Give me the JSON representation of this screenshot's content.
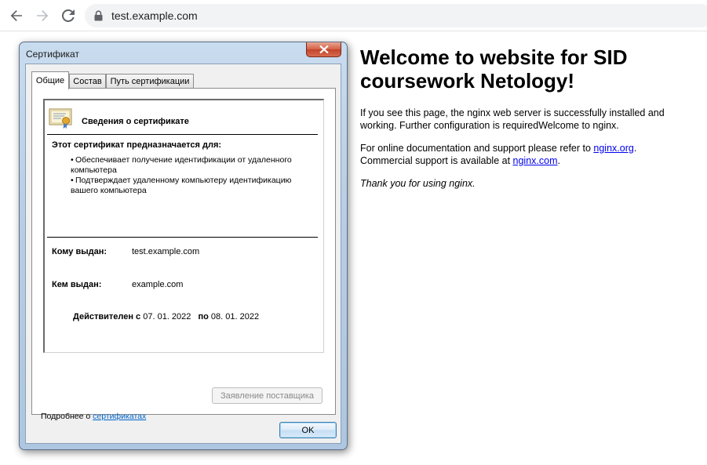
{
  "browser": {
    "url": "test.example.com",
    "back_icon": "arrow-left-icon",
    "forward_icon": "arrow-right-icon",
    "reload_icon": "reload-icon",
    "lock_icon": "lock-icon"
  },
  "page": {
    "heading": "Welcome to website for SID coursework Netology!",
    "para1": "If you see this page, the nginx web server is successfully installed and working. Further configuration is requiredWelcome to nginx.",
    "para2_before": "For online documentation and support please refer to ",
    "link1": "nginx.org",
    "para2_middle": ".\nCommercial support is available at ",
    "link2": "nginx.com",
    "para2_after": ".",
    "para3": "Thank you for using nginx.",
    "link_color": "#0000ee"
  },
  "dialog": {
    "title": "Сертификат",
    "close_icon": "close-icon",
    "tabs": [
      {
        "label": "Общие",
        "active": true
      },
      {
        "label": "Состав",
        "active": false
      },
      {
        "label": "Путь сертификации",
        "active": false
      }
    ],
    "info_heading": "Сведения о сертификате",
    "purpose_heading": "Этот сертификат предназначается для:",
    "purposes": [
      "Обеспечивает получение идентификации от удаленного компьютера",
      "Подтверждает удаленному компьютеру идентификацию вашего компьютера"
    ],
    "issued_to_label": "Кому выдан:",
    "issued_to_value": "test.example.com",
    "issued_by_label": "Кем выдан:",
    "issued_by_value": "example.com",
    "valid_from_label": "Действителен с",
    "valid_from_value": "07. 01. 2022",
    "valid_to_label": "по",
    "valid_to_value": "08. 01. 2022",
    "issuer_statement_button": "Заявление поставщика",
    "more_info_prefix": "Подробнее о ",
    "more_info_link": "сертификатах",
    "ok_button": "OK",
    "title_bar_color": "#c9dcef",
    "close_button_color": "#c2432a"
  }
}
